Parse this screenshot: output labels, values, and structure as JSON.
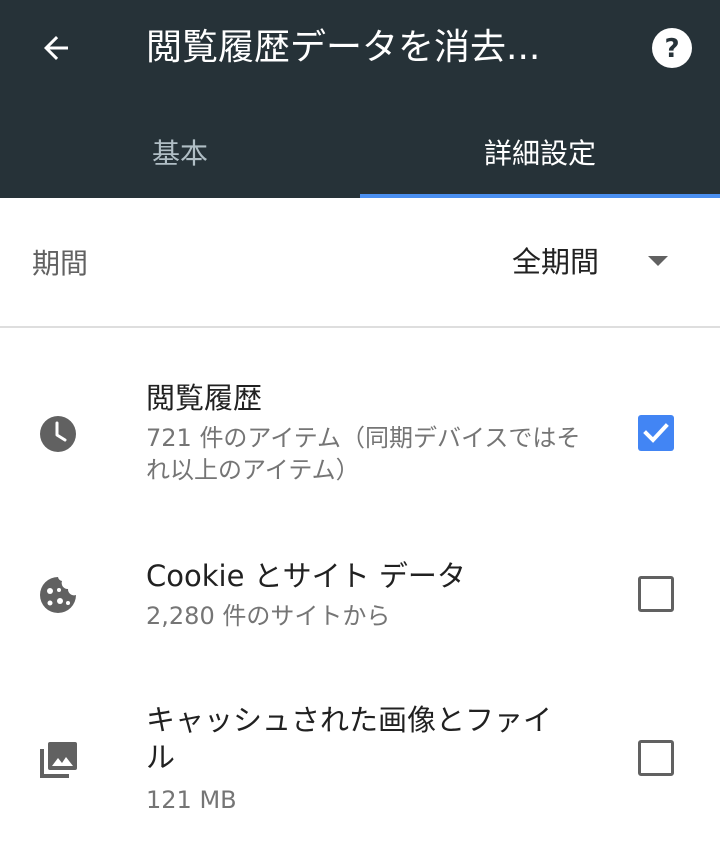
{
  "header": {
    "title": "閲覧履歴データを消去...",
    "back_icon": "arrow-back-icon",
    "help_icon": "help-icon",
    "background_color": "#263238"
  },
  "tabs": [
    {
      "label": "基本",
      "selected": false
    },
    {
      "label": "詳細設定",
      "selected": true
    }
  ],
  "accent_color": "#4285f4",
  "period": {
    "label": "期間",
    "value": "全期間"
  },
  "items": [
    {
      "title": "閲覧履歴",
      "subtitle": "721 件のアイテム（同期デバイスではそれ以上のアイテム）",
      "icon": "clock-icon",
      "checked": true
    },
    {
      "title": "Cookie とサイト データ",
      "subtitle": "2,280 件のサイトから",
      "icon": "cookie-icon",
      "checked": false
    },
    {
      "title": "キャッシュされた画像とファイル",
      "subtitle": "121 MB",
      "icon": "photo-library-icon",
      "checked": false
    }
  ]
}
